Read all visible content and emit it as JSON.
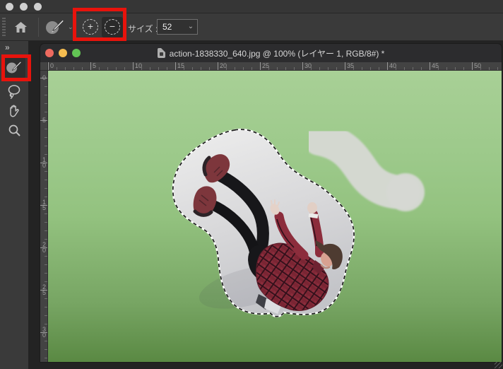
{
  "annotations": {
    "highlight_red_boxes": [
      {
        "target": "brush-size-add-subtract-buttons"
      },
      {
        "target": "tool-panel-brush-tool"
      }
    ],
    "highlight_color": "#e8130c"
  },
  "app_topbar": {
    "window_controls": [
      "inactive",
      "inactive",
      "inactive"
    ]
  },
  "options_bar": {
    "home_icon": "home-icon",
    "active_tool_icon": "brush-tool-icon",
    "tool_dropdown_glyph": "⌄",
    "add_brush_button": {
      "glyph": "+",
      "selected": false
    },
    "subtract_brush_button": {
      "glyph": "−",
      "selected": true
    },
    "size_label": "サイズ :",
    "size_value": "52",
    "size_dropdown_glyph": "⌄"
  },
  "tool_panel": {
    "expand_glyph": "»",
    "tools": [
      {
        "name": "brush",
        "selected": true
      },
      {
        "name": "lasso",
        "selected": false
      },
      {
        "name": "hand",
        "selected": false
      },
      {
        "name": "zoom",
        "selected": false
      }
    ]
  },
  "document_window": {
    "title": "action-1838330_640.jpg @ 100% (レイヤー 1, RGB/8#) *",
    "traffic_lights": [
      "close",
      "minimize",
      "fullscreen"
    ],
    "rulers": {
      "horizontal_labels": [
        "0",
        "5",
        "10",
        "15",
        "20",
        "25",
        "30",
        "35",
        "40",
        "45",
        "50"
      ],
      "vertical_labels": [
        "0",
        "5",
        "10",
        "15",
        "20",
        "25",
        "30"
      ]
    },
    "canvas_contents": [
      "green-background",
      "white-brush-stroke-blob",
      "selection-marching-ants",
      "falling-man-photo"
    ]
  },
  "colors": {
    "canvas_green_top": "#a8d096",
    "canvas_green_bottom": "#5a8943",
    "selection_blob_fill": "#dadadc",
    "brush_stroke_blob": "#d6d8d3",
    "highlight_red": "#e8130c",
    "panel_gray": "#3a3a3a"
  }
}
